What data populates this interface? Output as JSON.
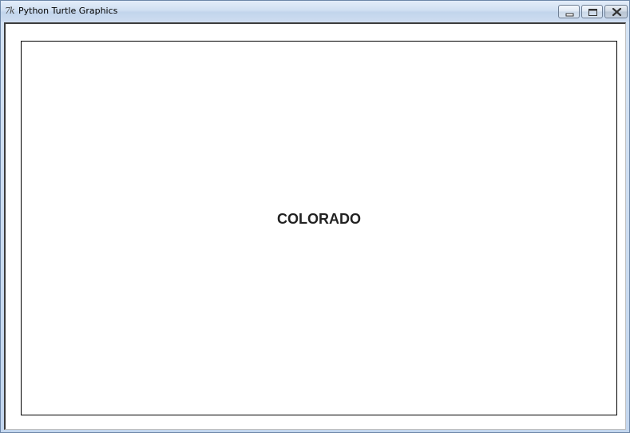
{
  "window": {
    "title": "Python Turtle Graphics",
    "icon": "tk-feather-icon"
  },
  "controls": {
    "minimize": "minimize-icon",
    "maximize": "maximize-icon",
    "close": "close-icon"
  },
  "canvas": {
    "text": "COLORADO",
    "background": "#ffffff",
    "border_color": "#000000",
    "text_color": "#222222"
  }
}
